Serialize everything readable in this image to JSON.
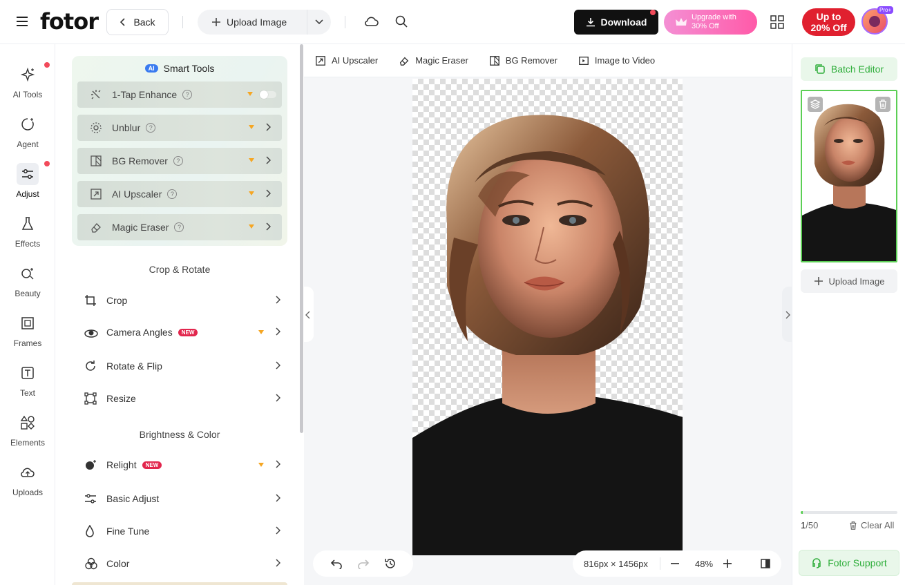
{
  "header": {
    "logo": "fotor",
    "back_label": "Back",
    "upload_label": "Upload Image",
    "download_label": "Download",
    "upgrade_line1": "Upgrade with",
    "upgrade_line2": "30% Off",
    "promo_line1": "Up to",
    "promo_line2": "20% Off",
    "pro_badge": "Pro+"
  },
  "leftnav": {
    "items": [
      {
        "label": "AI Tools",
        "icon": "sparkle-icon"
      },
      {
        "label": "Agent",
        "icon": "agent-icon"
      },
      {
        "label": "Adjust",
        "icon": "sliders-icon"
      },
      {
        "label": "Effects",
        "icon": "flask-icon"
      },
      {
        "label": "Beauty",
        "icon": "beauty-icon"
      },
      {
        "label": "Frames",
        "icon": "frame-icon"
      },
      {
        "label": "Text",
        "icon": "text-icon"
      },
      {
        "label": "Elements",
        "icon": "shapes-icon"
      },
      {
        "label": "Uploads",
        "icon": "cloud-upload-icon"
      }
    ]
  },
  "smart_tools": {
    "badge": "AI",
    "title": "Smart Tools",
    "items": [
      {
        "label": "1-Tap Enhance"
      },
      {
        "label": "Unblur"
      },
      {
        "label": "BG Remover"
      },
      {
        "label": "AI Upscaler"
      },
      {
        "label": "Magic Eraser"
      }
    ]
  },
  "crop_section": {
    "title": "Crop & Rotate",
    "items": [
      {
        "label": "Crop"
      },
      {
        "label": "Camera Angles",
        "badge": "NEW"
      },
      {
        "label": "Rotate & Flip"
      },
      {
        "label": "Resize"
      }
    ]
  },
  "color_section": {
    "title": "Brightness & Color",
    "items": [
      {
        "label": "Relight",
        "badge": "NEW"
      },
      {
        "label": "Basic Adjust"
      },
      {
        "label": "Fine Tune"
      },
      {
        "label": "Color"
      }
    ]
  },
  "toolstrip": {
    "items": [
      {
        "label": "AI Upscaler"
      },
      {
        "label": "Magic Eraser"
      },
      {
        "label": "BG Remover"
      },
      {
        "label": "Image to Video"
      }
    ]
  },
  "canvas": {
    "dimensions": "816px × 1456px",
    "zoom": "48%"
  },
  "right": {
    "batch_label": "Batch Editor",
    "upload_label": "Upload Image",
    "count_current": "1",
    "count_total": "/50",
    "progress": 0.02,
    "clear_label": "Clear All",
    "support_label": "Fotor Support"
  },
  "colors": {
    "accent_green": "#2fae3b",
    "promo_red": "#e0202f",
    "new_badge": "#e2264d",
    "crown": "#f5a623"
  }
}
